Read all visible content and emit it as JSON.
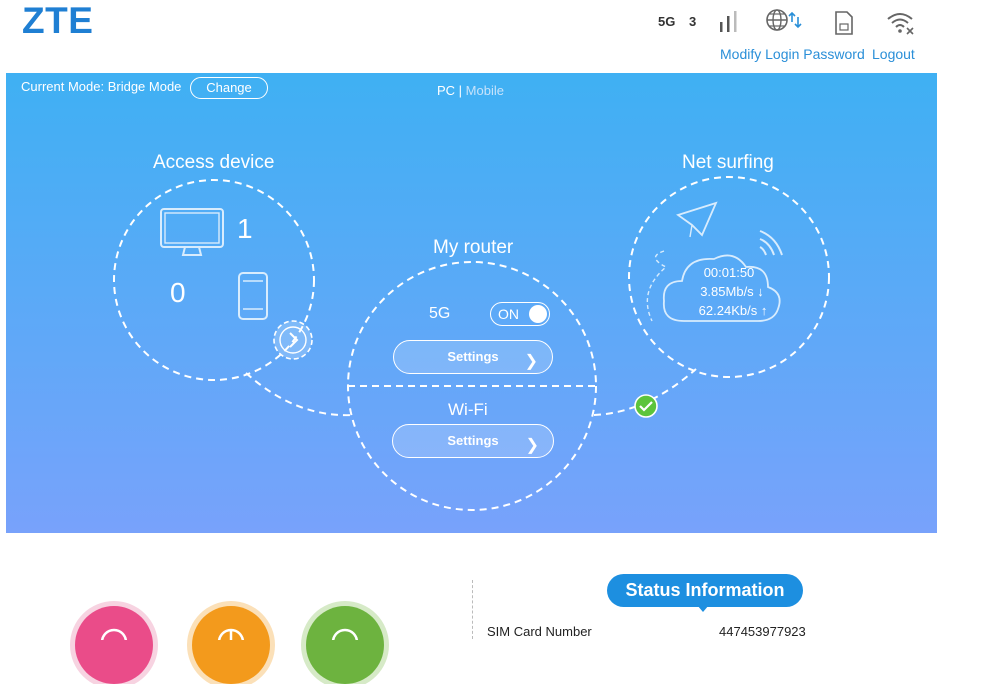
{
  "brand": {
    "logo": "ZTE"
  },
  "status_bar": {
    "network_type": "5G",
    "signal_count": "3",
    "modify_password": "Modify Login Password",
    "logout": "Logout",
    "icons": [
      "signal-bars-icon",
      "globe-data-icon",
      "sim-card-icon",
      "wifi-off-icon"
    ]
  },
  "hero": {
    "current_mode": "Current Mode: Bridge Mode",
    "change_label": "Change",
    "view_pc": "PC",
    "view_sep": " | ",
    "view_mobile": "Mobile",
    "access_device": {
      "title": "Access device",
      "pc_count": "1",
      "mobile_count": "0"
    },
    "my_router": {
      "title": "My router",
      "band_label": "5G",
      "toggle_label": "ON",
      "settings_5g": "Settings",
      "wifi_label": "Wi-Fi",
      "settings_wifi": "Settings"
    },
    "net_surfing": {
      "title": "Net surfing",
      "duration": "00:01:50",
      "download": "3.85Mb/s ↓",
      "upload": "62.24Kb/s ↑"
    }
  },
  "status_info": {
    "title": "Status Information",
    "rows": [
      {
        "label": "SIM Card Number",
        "value": "447453977923"
      }
    ]
  },
  "colors": {
    "brand_blue": "#1f7fd3",
    "link_blue": "#2a8fd8",
    "hero_top": "#3fb0f3",
    "hero_bottom": "#78a2fb",
    "status_pill": "#1d8fe0",
    "check_green": "#5cc43c",
    "circle_pink": "#ea4c89",
    "circle_orange": "#f39a1c",
    "circle_green": "#6db33f"
  }
}
